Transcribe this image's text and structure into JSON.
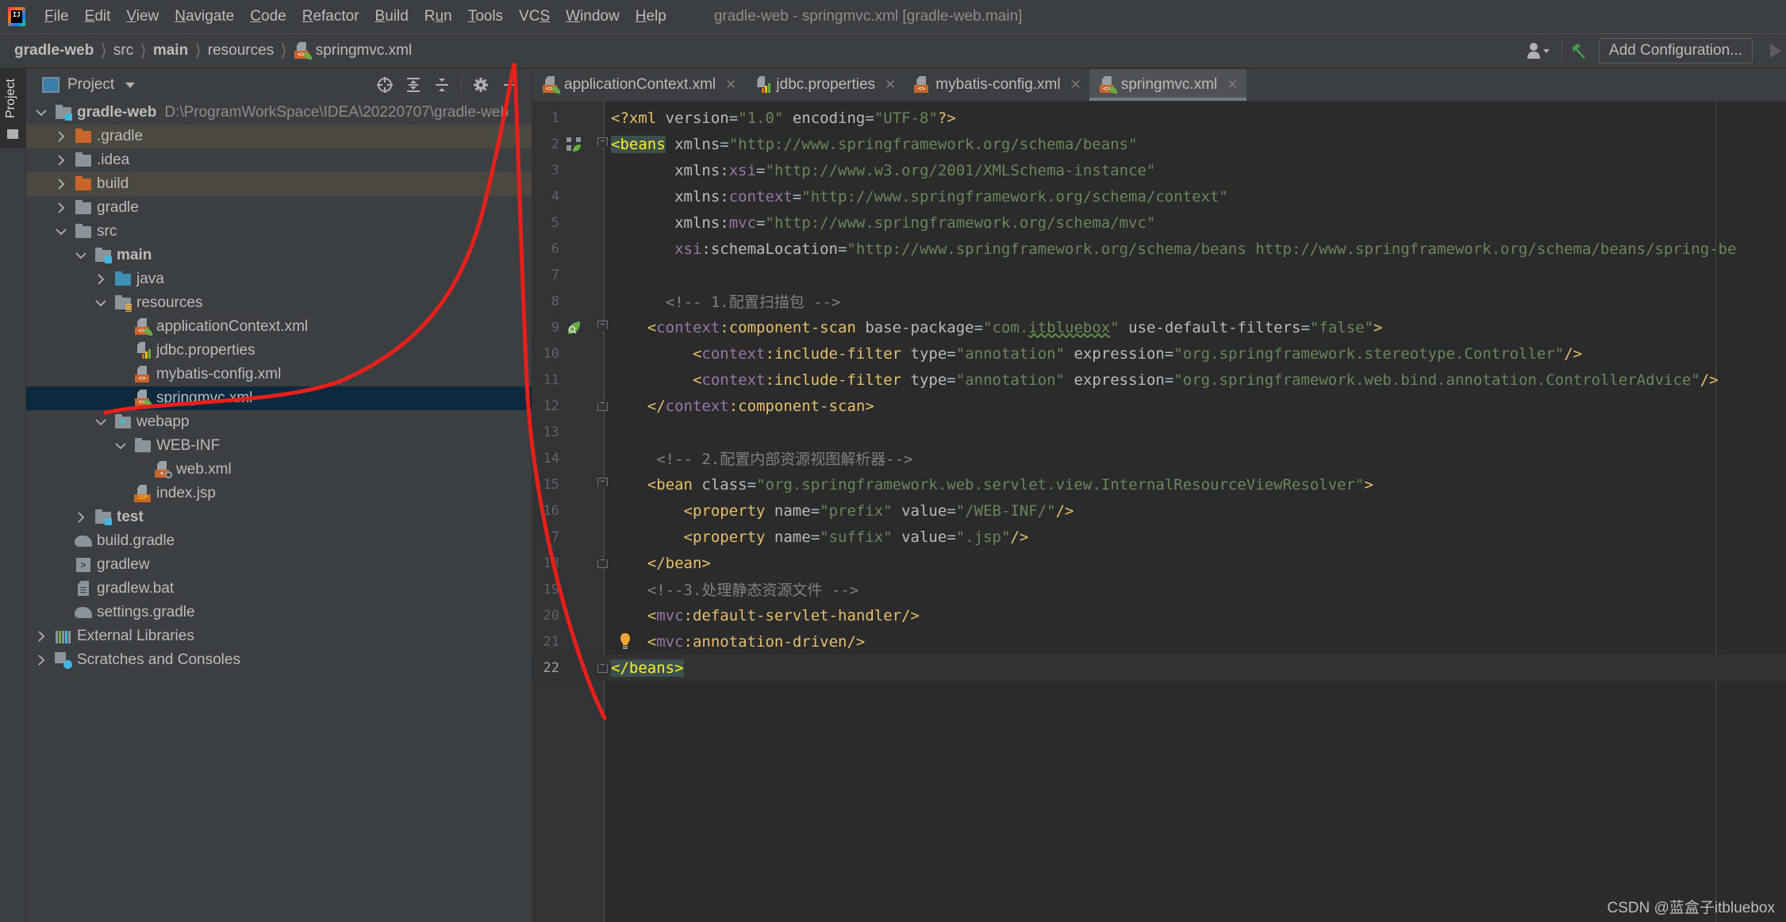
{
  "menu": {
    "items": [
      {
        "label": "File",
        "mnemonic": "F"
      },
      {
        "label": "Edit",
        "mnemonic": "E"
      },
      {
        "label": "View",
        "mnemonic": "V"
      },
      {
        "label": "Navigate",
        "mnemonic": "N"
      },
      {
        "label": "Code",
        "mnemonic": "C"
      },
      {
        "label": "Refactor",
        "mnemonic": "R"
      },
      {
        "label": "Build",
        "mnemonic": "B"
      },
      {
        "label": "Run",
        "mnemonic": "u"
      },
      {
        "label": "Tools",
        "mnemonic": "T"
      },
      {
        "label": "VCS",
        "mnemonic": "S"
      },
      {
        "label": "Window",
        "mnemonic": "W"
      },
      {
        "label": "Help",
        "mnemonic": "H"
      }
    ],
    "window_title": "gradle-web - springmvc.xml [gradle-web.main]"
  },
  "breadcrumb": {
    "items": [
      {
        "label": "gradle-web",
        "bold": true
      },
      {
        "label": "src",
        "bold": false
      },
      {
        "label": "main",
        "bold": true
      },
      {
        "label": "resources",
        "bold": false
      },
      {
        "label": "springmvc.xml",
        "bold": false,
        "icon": "spring-xml-file-icon"
      }
    ]
  },
  "toolbar": {
    "add_configuration_label": "Add Configuration..."
  },
  "tool_strip": {
    "project_tab_label": "Project"
  },
  "project_panel": {
    "title": "Project",
    "tree": [
      {
        "name": "gradle-web",
        "path": "D:\\ProgramWorkSpace\\IDEA\\20220707\\gradle-web",
        "depth": 0,
        "expanded": true,
        "icon": "module-folder",
        "bold": true
      },
      {
        "name": ".gradle",
        "depth": 1,
        "expanded": false,
        "icon": "folder-orange",
        "excluded": true
      },
      {
        "name": ".idea",
        "depth": 1,
        "expanded": false,
        "icon": "folder-gray"
      },
      {
        "name": "build",
        "depth": 1,
        "expanded": false,
        "icon": "folder-orange",
        "excluded": true
      },
      {
        "name": "gradle",
        "depth": 1,
        "expanded": false,
        "icon": "folder-gray"
      },
      {
        "name": "src",
        "depth": 1,
        "expanded": true,
        "icon": "folder-gray"
      },
      {
        "name": "main",
        "depth": 2,
        "expanded": true,
        "icon": "module-folder",
        "bold": true
      },
      {
        "name": "java",
        "depth": 3,
        "expanded": false,
        "icon": "folder-blue"
      },
      {
        "name": "resources",
        "depth": 3,
        "expanded": true,
        "icon": "resources-folder"
      },
      {
        "name": "applicationContext.xml",
        "depth": 4,
        "icon": "spring-xml"
      },
      {
        "name": "jdbc.properties",
        "depth": 4,
        "icon": "properties"
      },
      {
        "name": "mybatis-config.xml",
        "depth": 4,
        "icon": "xml"
      },
      {
        "name": "springmvc.xml",
        "depth": 4,
        "icon": "spring-xml",
        "selected": true
      },
      {
        "name": "webapp",
        "depth": 3,
        "expanded": true,
        "icon": "web-folder"
      },
      {
        "name": "WEB-INF",
        "depth": 4,
        "expanded": true,
        "icon": "folder-gray"
      },
      {
        "name": "web.xml",
        "depth": 5,
        "icon": "web-xml"
      },
      {
        "name": "index.jsp",
        "depth": 4,
        "icon": "jsp"
      },
      {
        "name": "test",
        "depth": 2,
        "expanded": false,
        "icon": "module-folder",
        "bold": true
      },
      {
        "name": "build.gradle",
        "depth": 1,
        "icon": "gradle"
      },
      {
        "name": "gradlew",
        "depth": 1,
        "icon": "shell"
      },
      {
        "name": "gradlew.bat",
        "depth": 1,
        "icon": "bat"
      },
      {
        "name": "settings.gradle",
        "depth": 1,
        "icon": "gradle"
      },
      {
        "name": "External Libraries",
        "depth": 0,
        "expanded": false,
        "icon": "libraries"
      },
      {
        "name": "Scratches and Consoles",
        "depth": 0,
        "expanded": false,
        "icon": "scratches"
      }
    ]
  },
  "editor": {
    "tabs": [
      {
        "label": "applicationContext.xml",
        "icon": "spring-xml",
        "active": false
      },
      {
        "label": "jdbc.properties",
        "icon": "properties",
        "active": false
      },
      {
        "label": "mybatis-config.xml",
        "icon": "xml",
        "active": false
      },
      {
        "label": "springmvc.xml",
        "icon": "spring-xml",
        "active": true
      }
    ],
    "caret_line": 22,
    "lines": [
      {
        "n": 1,
        "tokens": [
          [
            "pi",
            "<?"
          ],
          [
            "tag",
            "xml "
          ],
          [
            "attr",
            "version"
          ],
          [
            "plain",
            "="
          ],
          [
            "str",
            "\"1.0\""
          ],
          [
            "plain",
            " "
          ],
          [
            "attr",
            "encoding"
          ],
          [
            "plain",
            "="
          ],
          [
            "str",
            "\"UTF-8\""
          ],
          [
            "pi",
            "?>"
          ]
        ]
      },
      {
        "n": 2,
        "gutter": "spring-bean-icon",
        "fold": "open",
        "tokens": [
          [
            "hl",
            "<beans"
          ],
          [
            "plain",
            " "
          ],
          [
            "attr",
            "xmlns"
          ],
          [
            "plain",
            "="
          ],
          [
            "str",
            "\"http://www.springframework.org/schema/beans\""
          ]
        ]
      },
      {
        "n": 3,
        "tokens": [
          [
            "plain",
            "       "
          ],
          [
            "attr",
            "xmlns:"
          ],
          [
            "ns",
            "xsi"
          ],
          [
            "plain",
            "="
          ],
          [
            "str",
            "\"http://www.w3.org/2001/XMLSchema-instance\""
          ]
        ]
      },
      {
        "n": 4,
        "tokens": [
          [
            "plain",
            "       "
          ],
          [
            "attr",
            "xmlns:"
          ],
          [
            "ns",
            "context"
          ],
          [
            "plain",
            "="
          ],
          [
            "str",
            "\"http://www.springframework.org/schema/context\""
          ]
        ]
      },
      {
        "n": 5,
        "tokens": [
          [
            "plain",
            "       "
          ],
          [
            "attr",
            "xmlns:"
          ],
          [
            "ns",
            "mvc"
          ],
          [
            "plain",
            "="
          ],
          [
            "str",
            "\"http://www.springframework.org/schema/mvc\""
          ]
        ]
      },
      {
        "n": 6,
        "tokens": [
          [
            "plain",
            "       "
          ],
          [
            "ns",
            "xsi"
          ],
          [
            "attr",
            ":schemaLocation"
          ],
          [
            "plain",
            "="
          ],
          [
            "str",
            "\"http://www.springframework.org/schema/beans http://www.springframework.org/schema/beans/spring-be"
          ]
        ]
      },
      {
        "n": 7,
        "tokens": []
      },
      {
        "n": 8,
        "tokens": [
          [
            "plain",
            "      "
          ],
          [
            "cmt",
            "<!-- 1.配置扫描包 -->"
          ]
        ]
      },
      {
        "n": 9,
        "gutter": "spring-scan-icon",
        "fold": "open",
        "tokens": [
          [
            "plain",
            "    "
          ],
          [
            "tag",
            "<"
          ],
          [
            "ns",
            "context"
          ],
          [
            "tag",
            ":component-scan"
          ],
          [
            "plain",
            " "
          ],
          [
            "attr",
            "base-package"
          ],
          [
            "plain",
            "="
          ],
          [
            "str",
            "\"com."
          ],
          [
            "typo",
            "itbluebox"
          ],
          [
            "str",
            "\""
          ],
          [
            "plain",
            " "
          ],
          [
            "attr",
            "use-default-filters"
          ],
          [
            "plain",
            "="
          ],
          [
            "str",
            "\"false\""
          ],
          [
            "tag",
            ">"
          ]
        ]
      },
      {
        "n": 10,
        "tokens": [
          [
            "plain",
            "         "
          ],
          [
            "tag",
            "<"
          ],
          [
            "ns",
            "context"
          ],
          [
            "tag",
            ":include-filter"
          ],
          [
            "plain",
            " "
          ],
          [
            "attr",
            "type"
          ],
          [
            "plain",
            "="
          ],
          [
            "str",
            "\"annotation\""
          ],
          [
            "plain",
            " "
          ],
          [
            "attr",
            "expression"
          ],
          [
            "plain",
            "="
          ],
          [
            "str",
            "\"org.springframework.stereotype.Controller\""
          ],
          [
            "tag",
            "/>"
          ]
        ]
      },
      {
        "n": 11,
        "tokens": [
          [
            "plain",
            "         "
          ],
          [
            "tag",
            "<"
          ],
          [
            "ns",
            "context"
          ],
          [
            "tag",
            ":include-filter"
          ],
          [
            "plain",
            " "
          ],
          [
            "attr",
            "type"
          ],
          [
            "plain",
            "="
          ],
          [
            "str",
            "\"annotation\""
          ],
          [
            "plain",
            " "
          ],
          [
            "attr",
            "expression"
          ],
          [
            "plain",
            "="
          ],
          [
            "str",
            "\"org.springframework.web.bind.annotation.ControllerAdvice\""
          ],
          [
            "tag",
            "/>"
          ]
        ]
      },
      {
        "n": 12,
        "fold": "close",
        "tokens": [
          [
            "plain",
            "    "
          ],
          [
            "tag",
            "</"
          ],
          [
            "ns",
            "context"
          ],
          [
            "tag",
            ":component-scan>"
          ]
        ]
      },
      {
        "n": 13,
        "tokens": []
      },
      {
        "n": 14,
        "tokens": [
          [
            "plain",
            "     "
          ],
          [
            "cmt",
            "<!-- 2.配置内部资源视图解析器-->"
          ]
        ]
      },
      {
        "n": 15,
        "fold": "open",
        "tokens": [
          [
            "plain",
            "    "
          ],
          [
            "tag",
            "<bean"
          ],
          [
            "plain",
            " "
          ],
          [
            "attr",
            "class"
          ],
          [
            "plain",
            "="
          ],
          [
            "str",
            "\"org.springframework.web.servlet.view.InternalResourceViewResolver\""
          ],
          [
            "tag",
            ">"
          ]
        ]
      },
      {
        "n": 16,
        "tokens": [
          [
            "plain",
            "        "
          ],
          [
            "tag",
            "<property"
          ],
          [
            "plain",
            " "
          ],
          [
            "attr",
            "name"
          ],
          [
            "plain",
            "="
          ],
          [
            "str",
            "\"prefix\""
          ],
          [
            "plain",
            " "
          ],
          [
            "attr",
            "value"
          ],
          [
            "plain",
            "="
          ],
          [
            "str",
            "\"/WEB-INF/\""
          ],
          [
            "tag",
            "/>"
          ]
        ]
      },
      {
        "n": 17,
        "tokens": [
          [
            "plain",
            "        "
          ],
          [
            "tag",
            "<property"
          ],
          [
            "plain",
            " "
          ],
          [
            "attr",
            "name"
          ],
          [
            "plain",
            "="
          ],
          [
            "str",
            "\"suffix\""
          ],
          [
            "plain",
            " "
          ],
          [
            "attr",
            "value"
          ],
          [
            "plain",
            "="
          ],
          [
            "str",
            "\".jsp\""
          ],
          [
            "tag",
            "/>"
          ]
        ]
      },
      {
        "n": 18,
        "fold": "close",
        "tokens": [
          [
            "plain",
            "    "
          ],
          [
            "tag",
            "</bean>"
          ]
        ]
      },
      {
        "n": 19,
        "tokens": [
          [
            "plain",
            "    "
          ],
          [
            "cmt",
            "<!--3.处理静态资源文件 -->"
          ]
        ]
      },
      {
        "n": 20,
        "tokens": [
          [
            "plain",
            "    "
          ],
          [
            "tag",
            "<"
          ],
          [
            "ns",
            "mvc"
          ],
          [
            "tag",
            ":default-servlet-handler/>"
          ]
        ]
      },
      {
        "n": 21,
        "bulb": true,
        "tokens": [
          [
            "plain",
            "    "
          ],
          [
            "tag",
            "<"
          ],
          [
            "ns",
            "mvc"
          ],
          [
            "tag",
            ":annotation-driven/>"
          ]
        ]
      },
      {
        "n": 22,
        "fold": "close",
        "tokens": [
          [
            "hl",
            "</beans>"
          ]
        ]
      }
    ]
  },
  "watermark": "CSDN @蓝盒子itbluebox",
  "colors": {
    "annotation_stroke": "#e8201c",
    "selection_bg": "#0d293e",
    "tag": "#e8bf6a",
    "string": "#6a8759",
    "namespace": "#9876aa",
    "comment": "#808080"
  }
}
